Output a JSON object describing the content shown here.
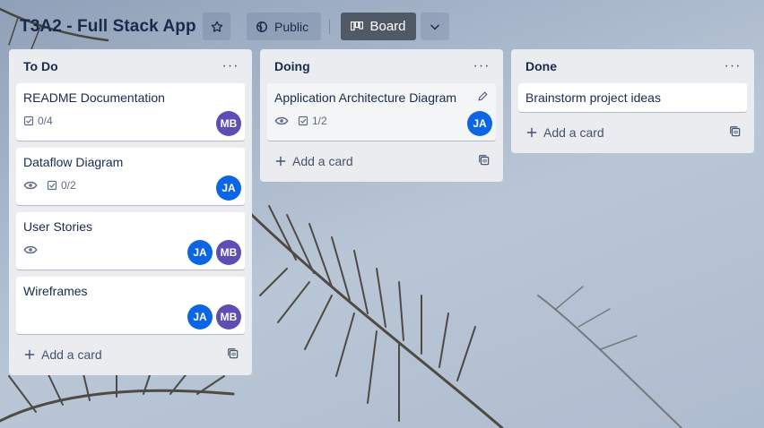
{
  "board": {
    "title": "T3A2 - Full Stack App",
    "visibility_label": "Public",
    "view_label": "Board"
  },
  "icons": {
    "star": "star-icon",
    "globe": "globe-icon",
    "board": "board-icon",
    "chevron": "chevron-down-icon",
    "eye": "eye-icon",
    "checklist": "checklist-icon",
    "plus": "plus-icon",
    "template": "template-icon",
    "pencil": "pencil-icon"
  },
  "colors": {
    "avatar_ja": "#0c66e4",
    "avatar_mb": "#5e4db2",
    "board_button": "#505a66"
  },
  "lists": [
    {
      "title": "To Do",
      "menu": "···",
      "add_label": "Add a card",
      "cards": [
        {
          "title": "README Documentation",
          "watch": false,
          "checklist": "0/4",
          "members": [
            "MB"
          ]
        },
        {
          "title": "Dataflow Diagram",
          "watch": true,
          "checklist": "0/2",
          "members": [
            "JA"
          ]
        },
        {
          "title": "User Stories",
          "watch": true,
          "checklist": "",
          "members": [
            "JA",
            "MB"
          ]
        },
        {
          "title": "Wireframes",
          "watch": false,
          "checklist": "",
          "members": [
            "JA",
            "MB"
          ]
        }
      ]
    },
    {
      "title": "Doing",
      "menu": "···",
      "add_label": "Add a card",
      "cards": [
        {
          "title": "Application Architecture Diagram",
          "watch": true,
          "checklist": "1/2",
          "members": [
            "JA"
          ]
        }
      ]
    },
    {
      "title": "Done",
      "menu": "···",
      "add_label": "Add a card",
      "cards": [
        {
          "title": "Brainstorm project ideas",
          "watch": false,
          "checklist": "",
          "members": []
        }
      ]
    }
  ]
}
